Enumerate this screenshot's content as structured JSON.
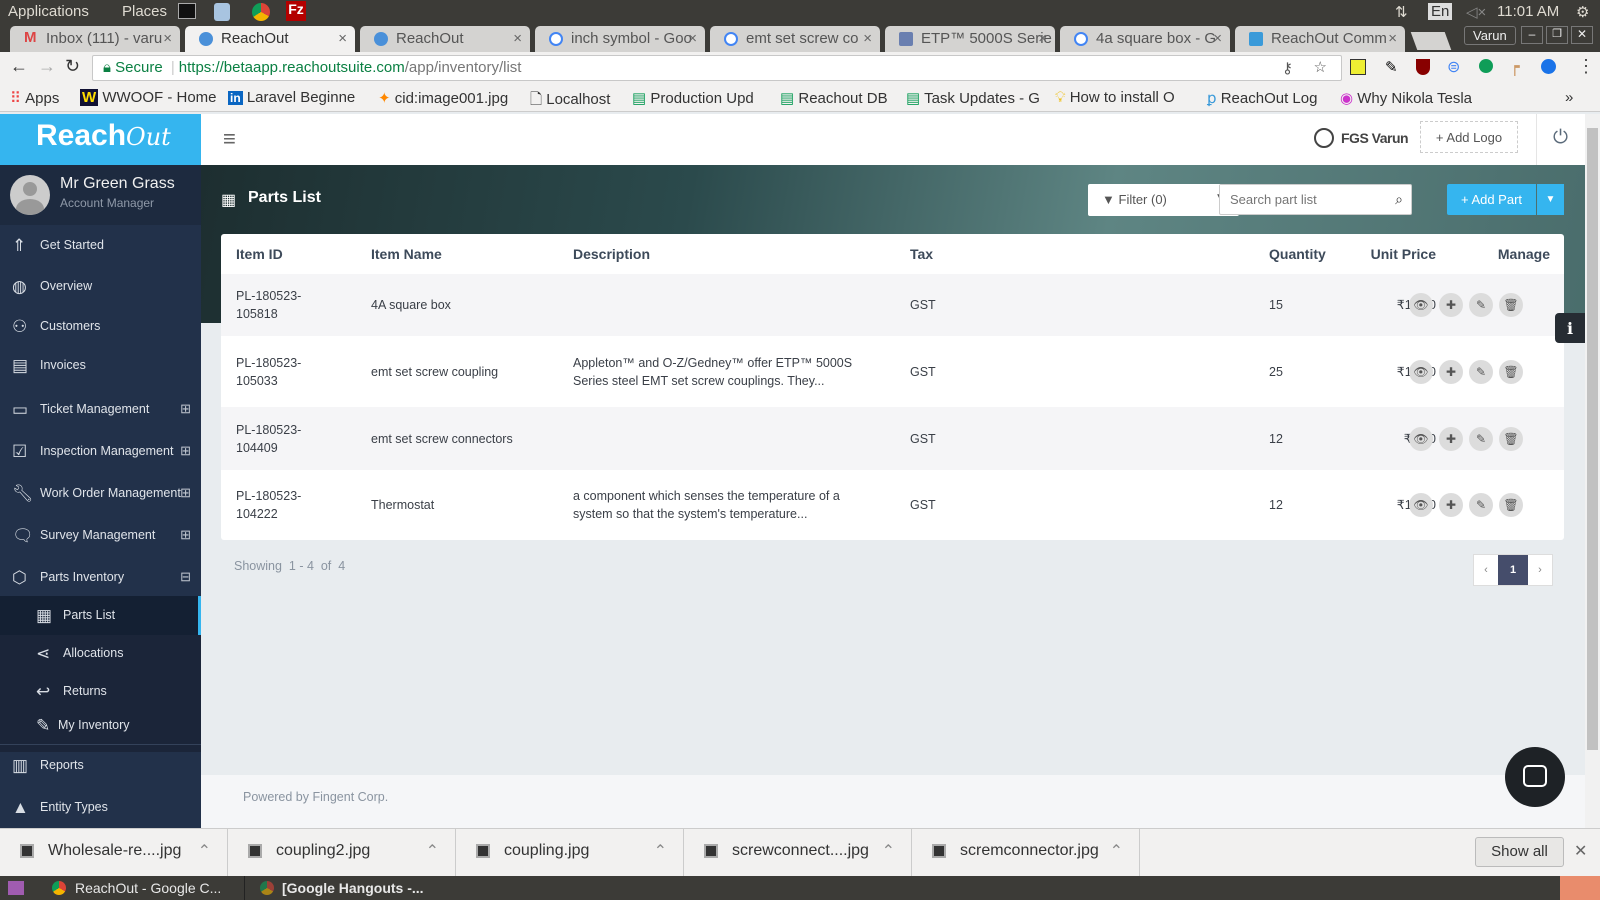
{
  "os": {
    "applications": "Applications",
    "places": "Places",
    "lang": "En",
    "time": "11:01 AM"
  },
  "browser": {
    "tabs": [
      {
        "label": "Inbox (111) - varu"
      },
      {
        "label": "ReachOut"
      },
      {
        "label": "ReachOut"
      },
      {
        "label": "inch symbol - Goo"
      },
      {
        "label": "emt set screw co"
      },
      {
        "label": "ETP™ 5000S Serie"
      },
      {
        "label": "4a square box - G"
      },
      {
        "label": "ReachOut Comm"
      }
    ],
    "profile": "Varun",
    "secure": "Secure",
    "url_host": "https://betaapp.reachoutsuite.com",
    "url_path": "/app/inventory/list",
    "bookmarks": [
      "Apps",
      "WWOOF - Home",
      "Laravel Beginne",
      "cid:image001.jpg",
      "Localhost",
      "Production Upd",
      "Reachout DB",
      "Task Updates - G",
      "How to install O",
      "ReachOut Log",
      "Why Nikola Tesla"
    ]
  },
  "app": {
    "logo": "Reach",
    "logo_script": "Out",
    "user": {
      "name": "Mr Green Grass",
      "role": "Account Manager"
    },
    "header": {
      "account": "FGS Varun",
      "add_logo": "+ Add Logo"
    },
    "nav": [
      {
        "label": "Get Started",
        "icon": "rocket-icon"
      },
      {
        "label": "Overview",
        "icon": "globe-icon"
      },
      {
        "label": "Customers",
        "icon": "users-icon"
      },
      {
        "label": "Invoices",
        "icon": "invoice-icon"
      },
      {
        "label": "Ticket Management",
        "icon": "monitor-icon",
        "toggle": "⊞"
      },
      {
        "label": "Inspection Management",
        "icon": "checklist-icon",
        "toggle": "⊞"
      },
      {
        "label": "Work Order Management",
        "icon": "wrench-icon",
        "toggle": "⊞"
      },
      {
        "label": "Survey Management",
        "icon": "chat-chart-icon",
        "toggle": "⊞"
      },
      {
        "label": "Parts Inventory",
        "icon": "box-icon",
        "toggle": "⊟"
      },
      {
        "label": "Parts List",
        "icon": "parts-list-icon",
        "active": true
      },
      {
        "label": "Allocations",
        "icon": "share-icon"
      },
      {
        "label": "Returns",
        "icon": "reply-icon"
      },
      {
        "label": "My Inventory",
        "icon": "edit-icon"
      },
      {
        "label": "Reports",
        "icon": "report-icon"
      },
      {
        "label": "Entity Types",
        "icon": "shapes-icon"
      }
    ],
    "page_title": "Parts List",
    "filter_label": "Filter (0)",
    "search_placeholder": "Search part list",
    "add_part": "+ Add Part",
    "columns": [
      "Item ID",
      "Item Name",
      "Description",
      "Tax",
      "Unit Price",
      "Quantity",
      "Manage"
    ],
    "rows": [
      {
        "id": "PL-180523-105818",
        "name": "4A square box",
        "description": "",
        "tax": "GST",
        "price": "₹12.00",
        "qty": "15"
      },
      {
        "id": "PL-180523-105033",
        "name": "emt set screw coupling",
        "description": "Appleton™ and O-Z/Gedney™ offer ETP™ 5000S Series steel EMT set screw couplings. They...",
        "tax": "GST",
        "price": "₹15.00",
        "qty": "25"
      },
      {
        "id": "PL-180523-104409",
        "name": "emt set screw connectors",
        "description": "",
        "tax": "GST",
        "price": "₹8.00",
        "qty": "12"
      },
      {
        "id": "PL-180523-104222",
        "name": "Thermostat",
        "description": "a component which senses the temperature of a system so that the system's temperature...",
        "tax": "GST",
        "price": "₹15.00",
        "qty": "12"
      }
    ],
    "showing": "Showing  1 - 4  of  4",
    "pagination": {
      "prev": "‹",
      "current": "1",
      "next": "›"
    },
    "footer": "Powered by Fingent Corp.",
    "colors": {
      "brand": "#35b5ef",
      "sidebar": "#22314a",
      "active_page": "#454d6b"
    }
  },
  "downloads": {
    "files": [
      "Wholesale-re....jpg",
      "coupling2.jpg",
      "coupling.jpg",
      "screwconnect....jpg",
      "scremconnector.jpg"
    ],
    "show_all": "Show all"
  },
  "taskbar": {
    "items": [
      "ReachOut - Google C...",
      "[Google Hangouts -..."
    ]
  }
}
